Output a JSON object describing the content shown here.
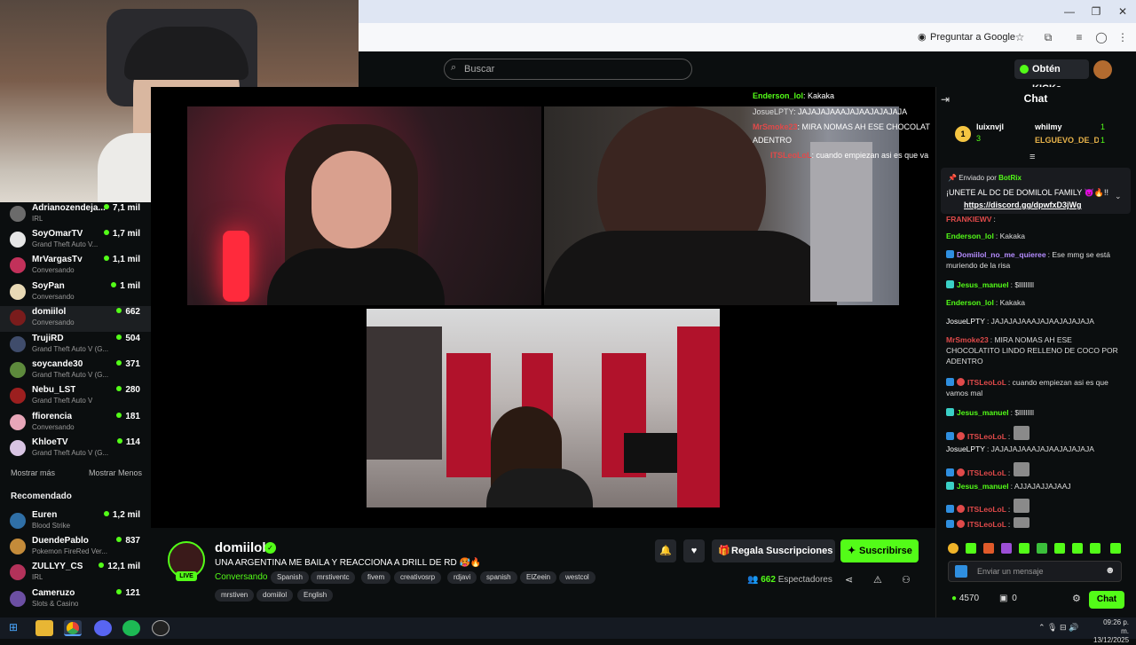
{
  "browser": {
    "ask_google": "Preguntar a Google"
  },
  "kick": {
    "search_placeholder": "Buscar",
    "kicks_label": "Obtén KICKs"
  },
  "sidebar": {
    "following": [
      {
        "name": "Adrianozendeja...",
        "category": "IRL",
        "viewers": "7,1 mil"
      },
      {
        "name": "SoyOmarTV",
        "category": "Grand Theft Auto V...",
        "viewers": "1,7 mil"
      },
      {
        "name": "MrVargasTv",
        "category": "Conversando",
        "viewers": "1,1 mil"
      },
      {
        "name": "SoyPan",
        "category": "Conversando",
        "viewers": "1 mil"
      },
      {
        "name": "domiilol",
        "category": "Conversando",
        "viewers": "662"
      },
      {
        "name": "TrujiRD",
        "category": "Grand Theft Auto V (G...",
        "viewers": "504"
      },
      {
        "name": "soycande30",
        "category": "Grand Theft Auto V (G...",
        "viewers": "371"
      },
      {
        "name": "Nebu_LST",
        "category": "Grand Theft Auto V",
        "viewers": "280"
      },
      {
        "name": "ffiorencia",
        "category": "Conversando",
        "viewers": "181"
      },
      {
        "name": "KhloeTV",
        "category": "Grand Theft Auto V (G...",
        "viewers": "114"
      }
    ],
    "show_more": "Mostrar más",
    "show_less": "Mostrar Menos",
    "recommended_title": "Recomendado",
    "recommended": [
      {
        "name": "Euren",
        "category": "Blood Strike",
        "viewers": "1,2 mil"
      },
      {
        "name": "DuendePablo",
        "category": "Pokemon FireRed Ver...",
        "viewers": "837"
      },
      {
        "name": "ZULLYY_CS",
        "category": "IRL",
        "viewers": "12,1 mil"
      },
      {
        "name": "Cameruzo",
        "category": "Slots & Casino",
        "viewers": "121"
      }
    ]
  },
  "overlay_chat": [
    {
      "user": "Enderson_lol",
      "text": ": Kakaka"
    },
    {
      "user": "JosueLPTY",
      "text": ": JAJAJAJAAAJAJAAJAJAJAJA"
    },
    {
      "user": "MrSmoke23",
      "text": ": MIRA NOMAS AH ESE CHOCOLAT"
    },
    {
      "user": "",
      "text": "ADENTRO"
    },
    {
      "user": "ITSLeoLoL",
      "text": ": cuando empiezan asi es que va"
    }
  ],
  "stream": {
    "streamer": "domiilol",
    "live_label": "LIVE",
    "title": "UNA ARGENTINA ME BAILA Y REACCIONA A DRILL DE RD 🥵🔥",
    "category": "Conversando",
    "tags": [
      "Spanish",
      "mrstiventc",
      "fivem",
      "creativosrp",
      "rdjavi",
      "spanish",
      "ElZeein",
      "westcol",
      "mrstiven",
      "domiilol",
      "English"
    ],
    "gift_label": "Regala Suscripciones",
    "subscribe_label": "Suscribirse",
    "viewers_count": "662",
    "viewers_label": "Espectadores"
  },
  "chat": {
    "title": "Chat",
    "leaders": [
      {
        "rank": "1",
        "name": "luixnvjl",
        "count": "3"
      },
      {
        "name": "whilmy",
        "count": "1"
      },
      {
        "name": "ELGUEVO_DE_D...",
        "count": "1"
      }
    ],
    "pinned_by_label": "Enviado por",
    "pinned_by": "BotRix",
    "pinned_text": "¡UNETE AL DC DE DOMILOL FAMILY 😈🔥!!",
    "pinned_link": "https://discord.gg/dpwfxD3jWg",
    "messages": [
      {
        "user": "FRANKIEWV",
        "text": ":",
        "color": "#e04a4a"
      },
      {
        "user": "Enderson_lol",
        "text": ": Kakaka",
        "color": "#53fc18"
      },
      {
        "user": "Domiilol_no_me_quieree",
        "text": ": Ese mmg se está muriendo de la risa",
        "color": "#b58cff"
      },
      {
        "user": "Jesus_manuel",
        "text": ": $lllllllll",
        "color": "#53fc18"
      },
      {
        "user": "Enderson_lol",
        "text": ": Kakaka",
        "color": "#53fc18"
      },
      {
        "user": "JosueLPTY",
        "text": ": JAJAJAJAAAJAJAAJAJAJAJA",
        "color": "#ffffff"
      },
      {
        "user": "MrSmoke23",
        "text": ": MIRA NOMAS AH ESE CHOCOLATITO LINDO RELLENO DE COCO POR ADENTRO",
        "color": "#e04a4a"
      },
      {
        "user": "ITSLeoLoL",
        "text": ": cuando empiezan asi es que vamos mal",
        "color": "#e04a4a"
      },
      {
        "user": "Jesus_manuel",
        "text": ": $lllllllll",
        "color": "#53fc18"
      },
      {
        "user": "ITSLeoLoL",
        "text": ":",
        "color": "#e04a4a"
      },
      {
        "user": "JosueLPTY",
        "text": ": JAJAJAJAAAJAJAAJAJAJAJA",
        "color": "#ffffff"
      },
      {
        "user": "ITSLeoLoL",
        "text": ":",
        "color": "#e04a4a"
      },
      {
        "user": "Jesus_manuel",
        "text": ": AJJAJAJJAJAAJ",
        "color": "#53fc18"
      },
      {
        "user": "ITSLeoLoL",
        "text": ":",
        "color": "#e04a4a"
      },
      {
        "user": "ITSLeoLoL",
        "text": ":",
        "color": "#e04a4a"
      }
    ],
    "input_placeholder": "Enviar un mensaje",
    "kicks_balance": "4570",
    "gift_balance": "0",
    "send_label": "Chat"
  },
  "taskbar": {
    "time": "09:26 p. m.",
    "date": "13/12/2025"
  },
  "colors": {
    "kick_green": "#53fc18",
    "background": "#0b0e0f"
  }
}
